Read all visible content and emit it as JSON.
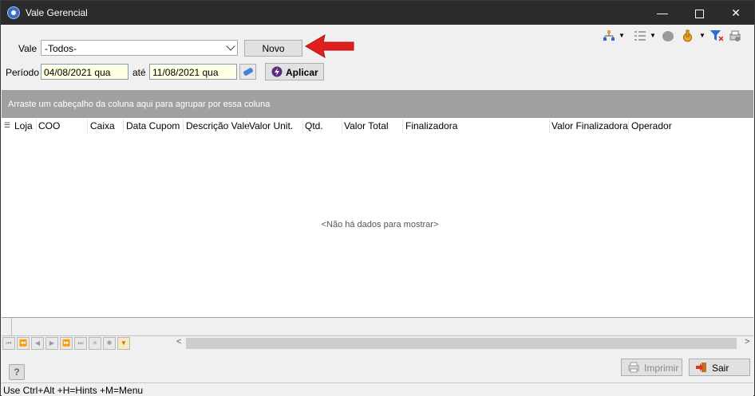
{
  "window": {
    "title": "Vale Gerencial",
    "controls": {
      "minimize": "—",
      "close": "✕"
    }
  },
  "filters": {
    "vale_label": "Vale",
    "vale_value": "-Todos-",
    "novo_label": "Novo",
    "periodo_label": "Período",
    "date_from": "04/08/2021 qua",
    "ate_label": "até",
    "date_to": "11/08/2021 qua",
    "aplicar_label": "Aplicar"
  },
  "toolbar": {
    "icons": [
      "tree-icon",
      "list-icon",
      "circle-icon",
      "hand-icon",
      "filter-icon",
      "print-setup-icon"
    ]
  },
  "grid": {
    "group_hint": "Arraste um cabeçalho da coluna aqui para agrupar por essa coluna",
    "columns": [
      "Loja",
      "COO",
      "Caixa",
      "Data Cupom",
      "Descrição Vale",
      "Valor Unit.",
      "Qtd.",
      "Valor Total",
      "Finalizadora",
      "Valor Finalizadora",
      "Operador"
    ],
    "empty_text": "<Não há dados para mostrar>"
  },
  "navigator": {
    "buttons": [
      "first",
      "prev-page",
      "prev",
      "next",
      "next-page",
      "last",
      "insert",
      "delete",
      "filter"
    ]
  },
  "footer": {
    "imprimir_label": "Imprimir",
    "sair_label": "Sair"
  },
  "statusbar": {
    "text": "Use Ctrl+Alt +H=Hints +M=Menu"
  },
  "colors": {
    "titlebar": "#2b2b2b",
    "group_bar": "#a0a0a0",
    "date_bg": "#ffffe1",
    "annotation_arrow": "#e0201e"
  }
}
